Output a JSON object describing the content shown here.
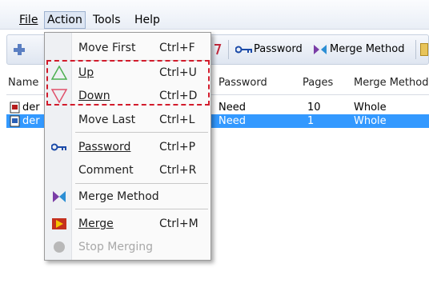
{
  "menubar": {
    "items": [
      {
        "label": "File"
      },
      {
        "label": "Action"
      },
      {
        "label": "Tools"
      },
      {
        "label": "Help"
      }
    ]
  },
  "toolbar": {
    "password_label": "Password",
    "merge_method_label": "Merge Method"
  },
  "list": {
    "columns": [
      "Name",
      "Password",
      "Pages",
      "Merge Method"
    ],
    "rows": [
      {
        "name": "der",
        "password": "Need",
        "pages": "10",
        "merge_method": "Whole"
      },
      {
        "name": "der",
        "password": "Need",
        "pages": "1",
        "merge_method": "Whole"
      }
    ]
  },
  "menu": {
    "items": [
      {
        "label": "Move First",
        "shortcut": "Ctrl+F"
      },
      {
        "label": "Up",
        "shortcut": "Ctrl+U"
      },
      {
        "label": "Down",
        "shortcut": "Ctrl+D"
      },
      {
        "label": "Move Last",
        "shortcut": "Ctrl+L"
      },
      {
        "label": "Password",
        "shortcut": "Ctrl+P"
      },
      {
        "label": "Comment",
        "shortcut": "Ctrl+R"
      },
      {
        "label": "Merge Method",
        "shortcut": ""
      },
      {
        "label": "Merge",
        "shortcut": "Ctrl+M"
      },
      {
        "label": "Stop Merging",
        "shortcut": ""
      }
    ]
  },
  "colors": {
    "selection": "#3399ff",
    "highlight_box": "#d21b2b",
    "up_icon": "#4caf50",
    "down_icon": "#e0506a"
  }
}
